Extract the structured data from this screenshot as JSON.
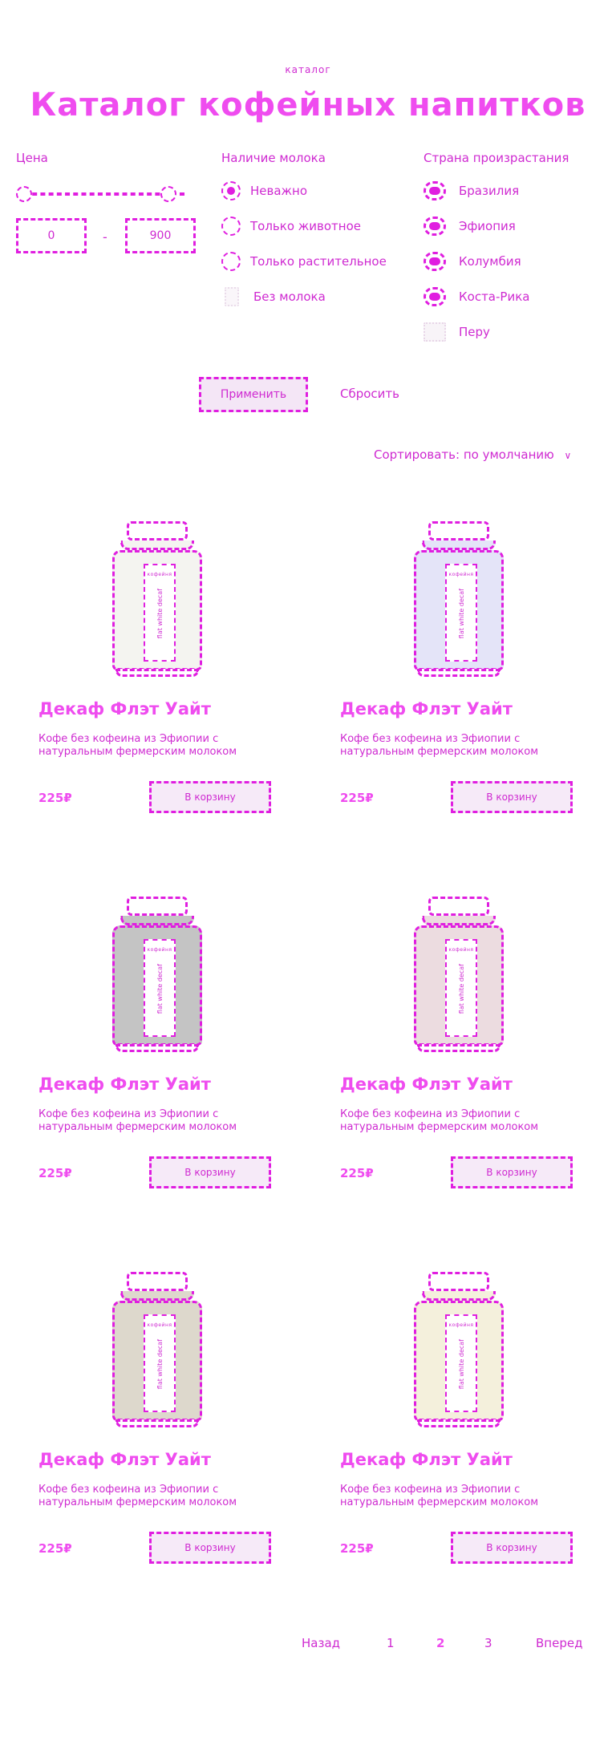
{
  "header": {
    "eyebrow": "каталог",
    "title": "Каталог кофейных напитков"
  },
  "filters": {
    "price": {
      "label": "Цена",
      "min_value": "0",
      "max_value": "900"
    },
    "milk": {
      "label": "Наличие молока",
      "options": [
        "Неважно",
        "Только животное",
        "Только растительное",
        "Без молока"
      ],
      "selected_index": 0
    },
    "country": {
      "label": "Страна произрастания",
      "options": [
        "Бразилия",
        "Эфиопия",
        "Колумбия",
        "Коста-Рика",
        "Перу"
      ],
      "checked": [
        true,
        true,
        true,
        true,
        false
      ]
    },
    "apply_label": "Применить",
    "reset_label": "Сбросить"
  },
  "sort": {
    "prefix": "Сортировать:",
    "value": "по умолчанию"
  },
  "colors": {
    "accent": "#e01ee0",
    "jar_tints": [
      "#f4f4f0",
      "#e4e4f8",
      "#c4c4c4",
      "#ecdce0",
      "#ddd8cc",
      "#f4f0dc"
    ]
  },
  "products": [
    {
      "title": "Декаф Флэт Уайт",
      "description": "Кофе без кофеина из Эфиопии с натуральным фермерским молоком",
      "price": "225₽",
      "cart_label": "В корзину",
      "jar_brand": "кофейня",
      "jar_text": "flat white decaf"
    },
    {
      "title": "Декаф Флэт Уайт",
      "description": "Кофе без кофеина из Эфиопии с натуральным фермерским молоком",
      "price": "225₽",
      "cart_label": "В корзину",
      "jar_brand": "кофейня",
      "jar_text": "flat white decaf"
    },
    {
      "title": "Декаф Флэт Уайт",
      "description": "Кофе без кофеина из Эфиопии с натуральным фермерским молоком",
      "price": "225₽",
      "cart_label": "В корзину",
      "jar_brand": "кофейня",
      "jar_text": "flat white decaf"
    },
    {
      "title": "Декаф Флэт Уайт",
      "description": "Кофе без кофеина из Эфиопии с натуральным фермерским молоком",
      "price": "225₽",
      "cart_label": "В корзину",
      "jar_brand": "кофейня",
      "jar_text": "flat white decaf"
    },
    {
      "title": "Декаф Флэт Уайт",
      "description": "Кофе без кофеина из Эфиопии с натуральным фермерским молоком",
      "price": "225₽",
      "cart_label": "В корзину",
      "jar_brand": "кофейня",
      "jar_text": "flat white decaf"
    },
    {
      "title": "Декаф Флэт Уайт",
      "description": "Кофе без кофеина из Эфиопии с натуральным фермерским молоком",
      "price": "225₽",
      "cart_label": "В корзину",
      "jar_brand": "кофейня",
      "jar_text": "flat white decaf"
    }
  ],
  "pagination": {
    "prev": "Назад",
    "pages": [
      "1",
      "2",
      "3"
    ],
    "current_index": 1,
    "next": "Вперед"
  }
}
